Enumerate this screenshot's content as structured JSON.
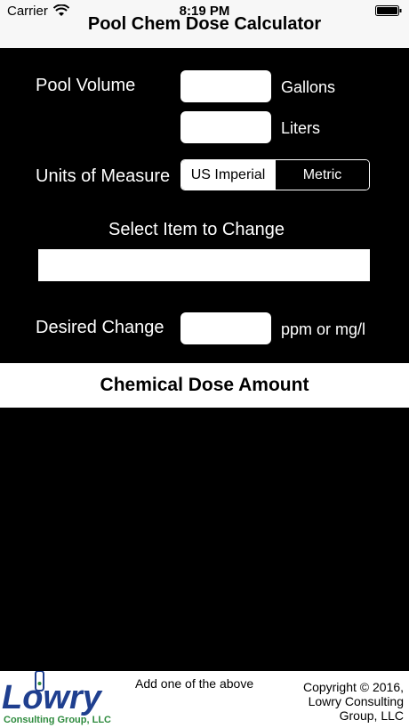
{
  "status": {
    "carrier": "Carrier",
    "time": "8:19 PM"
  },
  "nav": {
    "title": "Pool Chem Dose Calculator"
  },
  "form": {
    "pool_volume_label": "Pool Volume",
    "gallons_value": "",
    "gallons_unit": "Gallons",
    "liters_value": "",
    "liters_unit": "Liters",
    "units_label": "Units of Measure",
    "units_options": [
      "US Imperial",
      "Metric"
    ],
    "units_selected": "US Imperial",
    "select_item_label": "Select Item to Change",
    "select_item_value": "",
    "desired_change_label": "Desired Change",
    "desired_change_value": "",
    "desired_change_unit": "ppm or mg/l"
  },
  "result": {
    "title": "Chemical Dose Amount"
  },
  "footer": {
    "logo_text": "Lowry",
    "logo_subtext": "Consulting Group, LLC",
    "hint": "Add one of the above",
    "copyright": "Copyright © 2016, Lowry Consulting Group, LLC"
  },
  "colors": {
    "nav_bg": "#f7f7f7",
    "background": "#000000",
    "logo_blue": "#1f3f8f",
    "logo_green": "#2e8b3e"
  }
}
